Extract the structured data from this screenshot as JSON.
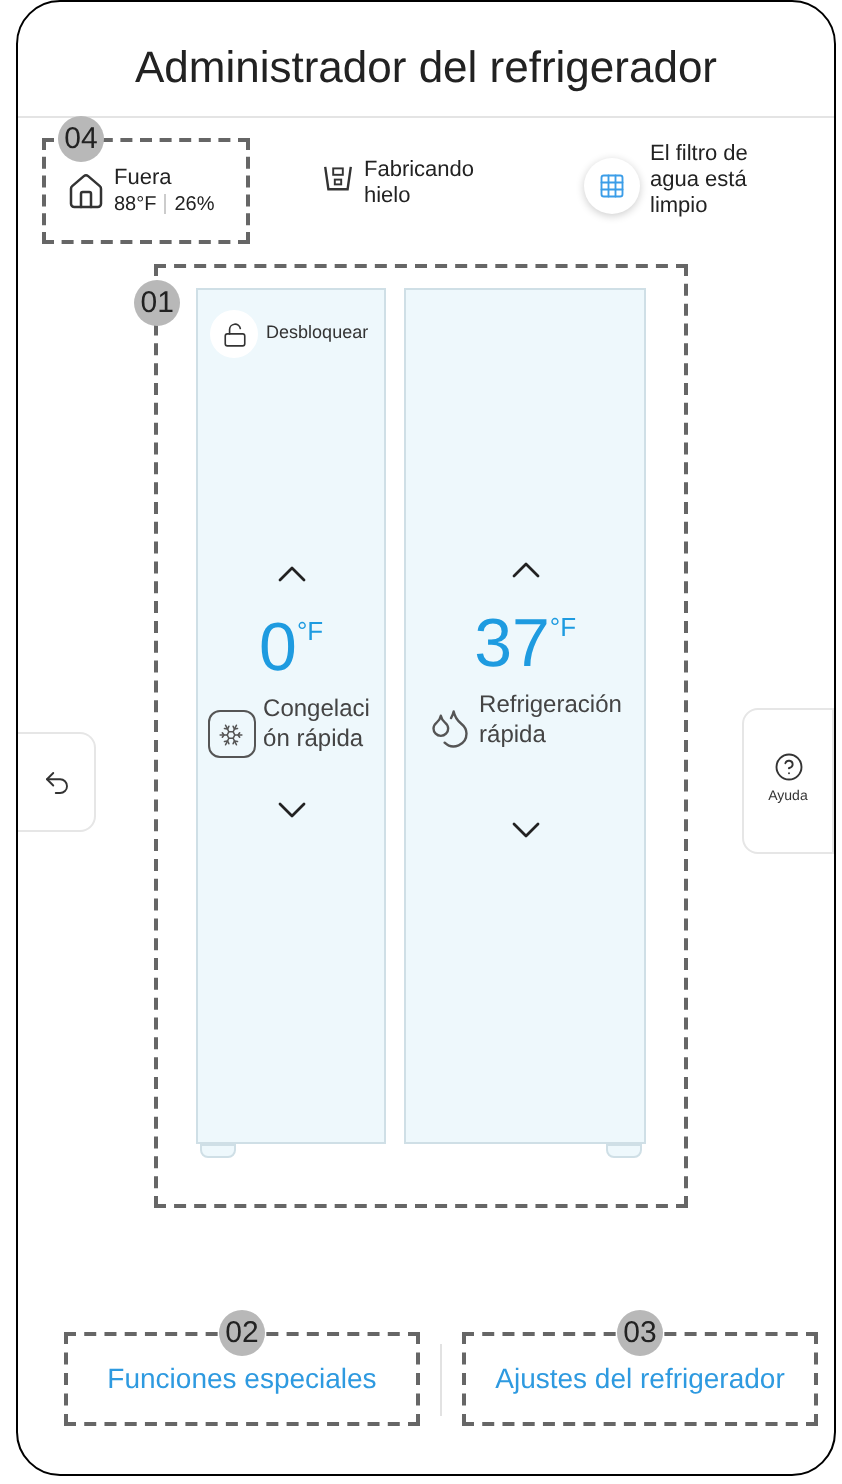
{
  "title": "Administrador del refrigerador",
  "status": [
    {
      "kind": "outside",
      "callout": "04",
      "label": "Fuera",
      "temperature": "88°F",
      "humidity": "26%"
    },
    {
      "kind": "ice",
      "label": "Fabricando hielo"
    },
    {
      "kind": "filter",
      "label": "El filtro de agua está limpio"
    }
  ],
  "fridge": {
    "callout": "01",
    "lock_label": "Desbloquear",
    "compartments": [
      {
        "kind": "freezer",
        "temperature": "0",
        "unit": "°F",
        "mode": "Congelación rápida"
      },
      {
        "kind": "fridge",
        "temperature": "37",
        "unit": "°F",
        "mode": "Refrigeración rápida"
      }
    ]
  },
  "help_label": "Ayuda",
  "bottom_links": [
    {
      "label": "Funciones especiales",
      "callout": "02"
    },
    {
      "label": "Ajustes del refrigerador",
      "callout": "03"
    }
  ]
}
